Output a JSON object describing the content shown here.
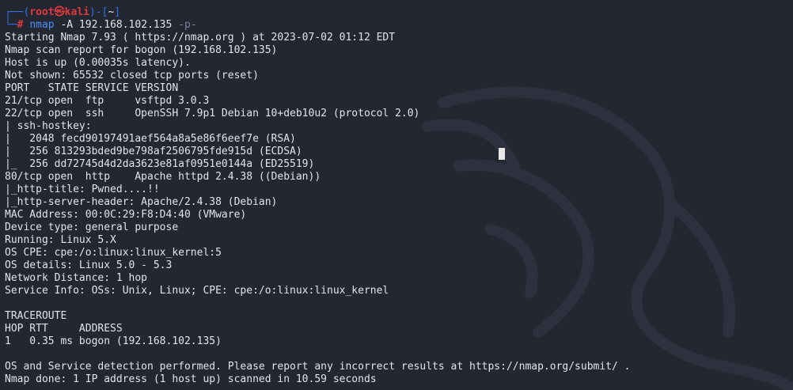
{
  "prompt": {
    "open": "┌──(",
    "user": "root",
    "at": "㉿",
    "host": "kali",
    "mid": ")-[",
    "dir": "~",
    "close": "]",
    "arrow": "└─",
    "symbol": "#"
  },
  "command": {
    "program": "nmap",
    "args": " -A 192.168.102.135 ",
    "trailing_flag": "-p-"
  },
  "output": [
    "Starting Nmap 7.93 ( https://nmap.org ) at 2023-07-02 01:12 EDT",
    "Nmap scan report for bogon (192.168.102.135)",
    "Host is up (0.00035s latency).",
    "Not shown: 65532 closed tcp ports (reset)",
    "PORT   STATE SERVICE VERSION",
    "21/tcp open  ftp     vsftpd 3.0.3",
    "22/tcp open  ssh     OpenSSH 7.9p1 Debian 10+deb10u2 (protocol 2.0)",
    "| ssh-hostkey: ",
    "|   2048 fecd90197491aef564a8a5e86f6eef7e (RSA)",
    "|   256 813293bded9be798af2506795fde915d (ECDSA)",
    "|_  256 dd72745d4d2da3623e81af0951e0144a (ED25519)",
    "80/tcp open  http    Apache httpd 2.4.38 ((Debian))",
    "|_http-title: Pwned....!!",
    "|_http-server-header: Apache/2.4.38 (Debian)",
    "MAC Address: 00:0C:29:F8:D4:40 (VMware)",
    "Device type: general purpose",
    "Running: Linux 5.X",
    "OS CPE: cpe:/o:linux:linux_kernel:5",
    "OS details: Linux 5.0 - 5.3",
    "Network Distance: 1 hop",
    "Service Info: OSs: Unix, Linux; CPE: cpe:/o:linux:linux_kernel",
    "",
    "TRACEROUTE",
    "HOP RTT     ADDRESS",
    "1   0.35 ms bogon (192.168.102.135)",
    "",
    "OS and Service detection performed. Please report any incorrect results at https://nmap.org/submit/ .",
    "Nmap done: 1 IP address (1 host up) scanned in 10.59 seconds"
  ],
  "colors": {
    "background": "#232732",
    "text": "#e2e4e8",
    "prompt_frame": "#2f6fe3",
    "prompt_user": "#e0383b",
    "command": "#4b8ff5",
    "dim_arg": "#7b8399",
    "cursor": "#e8e8e8"
  },
  "background_art": "kali-dragon-watermark"
}
